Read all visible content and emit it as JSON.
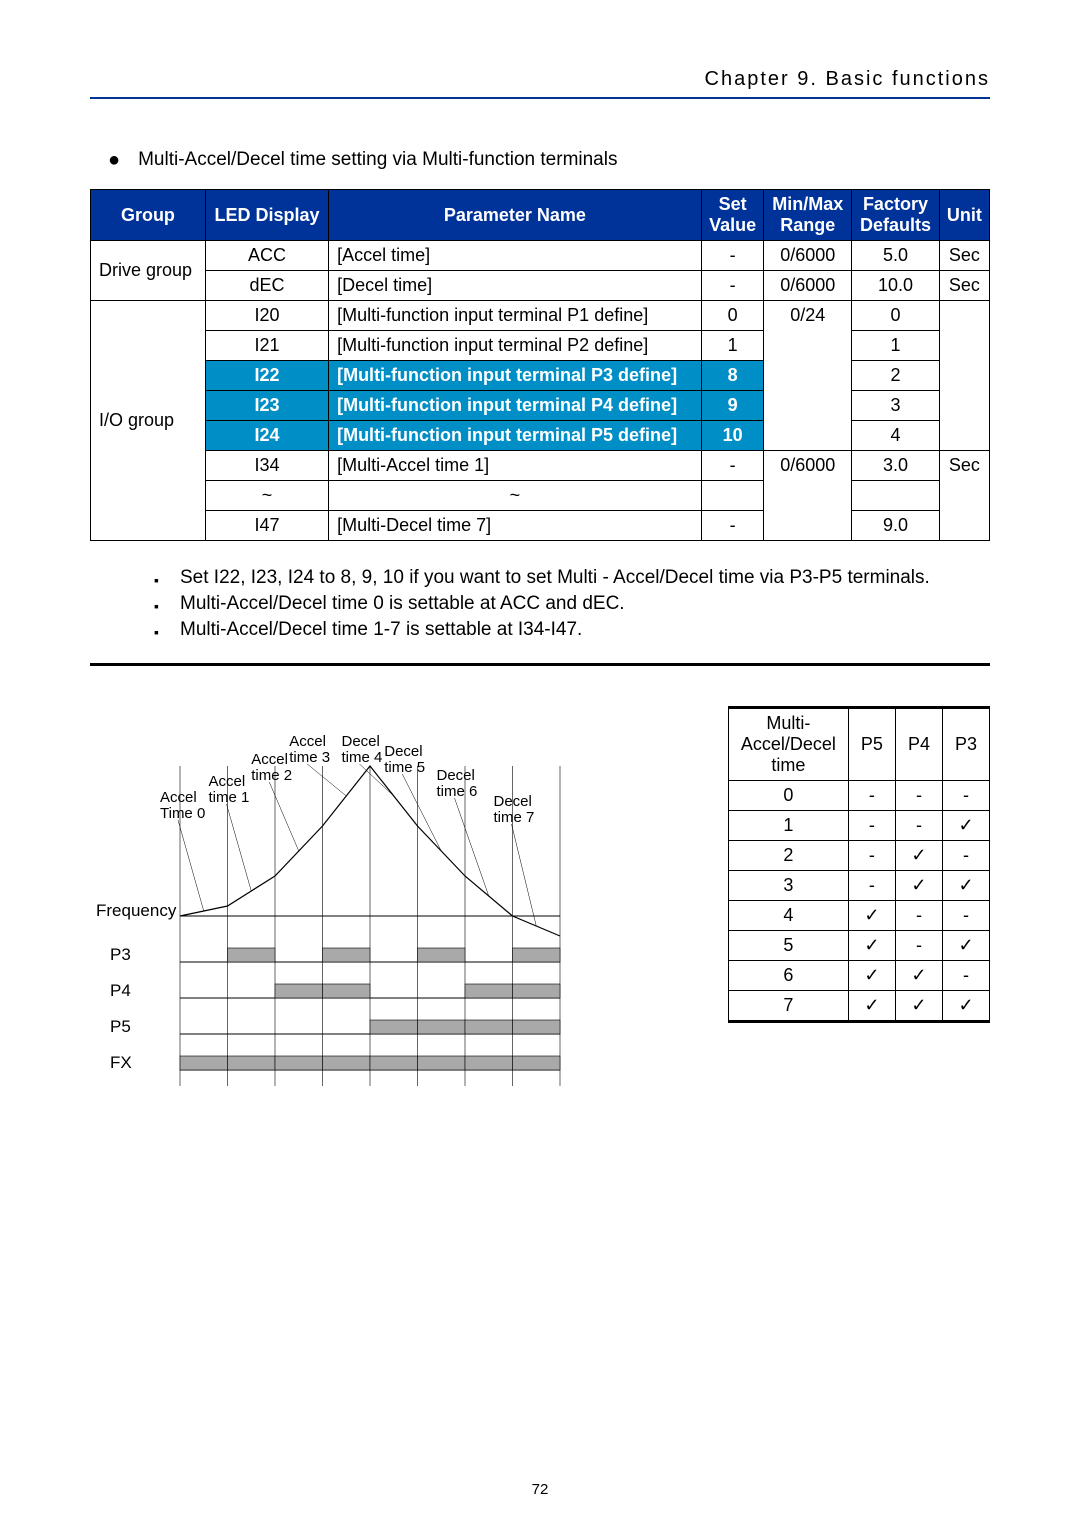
{
  "header": {
    "chapter": "Chapter 9. Basic functions"
  },
  "intro": "Multi-Accel/Decel time setting via Multi-function terminals",
  "param_table": {
    "headers": [
      "Group",
      "LED Display",
      "Parameter Name",
      "Set Value",
      "Min/Max Range",
      "Factory Defaults",
      "Unit"
    ],
    "groups": [
      {
        "name": "Drive group",
        "rows": [
          {
            "led": "ACC",
            "param": "[Accel time]",
            "set": "-",
            "range": "0/6000",
            "def": "5.0",
            "unit": "Sec",
            "hl": false
          },
          {
            "led": "dEC",
            "param": "[Decel time]",
            "set": "-",
            "range": "0/6000",
            "def": "10.0",
            "unit": "Sec",
            "hl": false
          }
        ]
      },
      {
        "name": "I/O group",
        "rows": [
          {
            "led": "I20",
            "param": "[Multi-function input terminal P1 define]",
            "set": "0",
            "range": "0/24",
            "def": "0",
            "unit": "",
            "hl": false
          },
          {
            "led": "I21",
            "param": "[Multi-function input terminal P2 define]",
            "set": "1",
            "range": "",
            "def": "1",
            "unit": "",
            "hl": false
          },
          {
            "led": "I22",
            "param": "[Multi-function input terminal P3 define]",
            "set": "8",
            "range": "",
            "def": "2",
            "unit": "",
            "hl": true
          },
          {
            "led": "I23",
            "param": "[Multi-function input terminal P4 define]",
            "set": "9",
            "range": "",
            "def": "3",
            "unit": "",
            "hl": true
          },
          {
            "led": "I24",
            "param": "[Multi-function input terminal P5 define]",
            "set": "10",
            "range": "",
            "def": "4",
            "unit": "",
            "hl": true
          },
          {
            "led": "I34",
            "param": "[Multi-Accel time 1]",
            "set": "-",
            "range": "0/6000",
            "def": "3.0",
            "unit": "Sec",
            "hl": false
          },
          {
            "led": "~",
            "param": "~",
            "set": "",
            "range": "",
            "def": "",
            "unit": "",
            "hl": false
          },
          {
            "led": "I47",
            "param": "[Multi-Decel time 7]",
            "set": "-",
            "range": "",
            "def": "9.0",
            "unit": "",
            "hl": false
          }
        ]
      }
    ]
  },
  "notes": [
    "Set I22, I23, I24 to 8, 9, 10 if you want to set Multi - Accel/Decel time via P3-P5 terminals.",
    "Multi-Accel/Decel time 0 is settable at ACC and dEC.",
    "Multi-Accel/Decel time 1-7 is settable at I34-I47."
  ],
  "truth_table": {
    "header": {
      "time": "Multi-\nAccel/Decel\ntime",
      "p5": "P5",
      "p4": "P4",
      "p3": "P3"
    },
    "rows": [
      {
        "t": "0",
        "p5": "-",
        "p4": "-",
        "p3": "-"
      },
      {
        "t": "1",
        "p5": "-",
        "p4": "-",
        "p3": "✓"
      },
      {
        "t": "2",
        "p5": "-",
        "p4": "✓",
        "p3": "-"
      },
      {
        "t": "3",
        "p5": "-",
        "p4": "✓",
        "p3": "✓"
      },
      {
        "t": "4",
        "p5": "✓",
        "p4": "-",
        "p3": "-"
      },
      {
        "t": "5",
        "p5": "✓",
        "p4": "-",
        "p3": "✓"
      },
      {
        "t": "6",
        "p5": "✓",
        "p4": "✓",
        "p3": "-"
      },
      {
        "t": "7",
        "p5": "✓",
        "p4": "✓",
        "p3": "✓"
      }
    ]
  },
  "chart_data": {
    "type": "area",
    "title": "",
    "axes": {
      "ylabel": "Frequency",
      "tracks": [
        "P3",
        "P4",
        "P5",
        "FX"
      ]
    },
    "segments": [
      {
        "label": "Accel Time 0",
        "kind": "accel"
      },
      {
        "label": "Accel time 1",
        "kind": "accel"
      },
      {
        "label": "Accel time 2",
        "kind": "accel"
      },
      {
        "label": "Accel time 3",
        "kind": "accel"
      },
      {
        "label": "Decel time 4",
        "kind": "decel"
      },
      {
        "label": "Decel time 5",
        "kind": "decel"
      },
      {
        "label": "Decel time 6",
        "kind": "decel"
      },
      {
        "label": "Decel time 7",
        "kind": "decel"
      }
    ],
    "digital": {
      "P3": [
        0,
        1,
        0,
        1,
        0,
        1,
        0,
        1
      ],
      "P4": [
        0,
        0,
        1,
        1,
        0,
        0,
        1,
        1
      ],
      "P5": [
        0,
        0,
        0,
        0,
        1,
        1,
        1,
        1
      ],
      "FX": [
        1,
        1,
        1,
        1,
        1,
        1,
        1,
        1
      ]
    },
    "slopes": [
      10,
      30,
      50,
      60,
      -60,
      -50,
      -40,
      -20
    ]
  },
  "page_number": "72"
}
